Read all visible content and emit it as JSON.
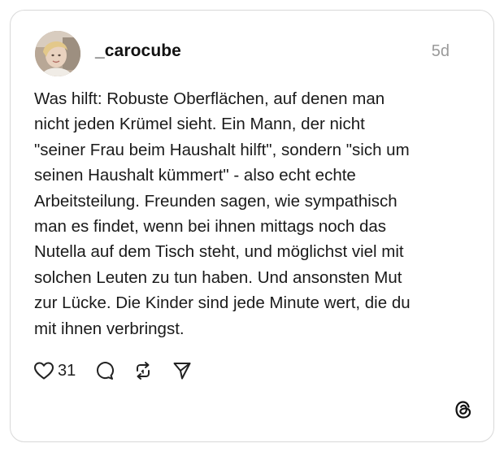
{
  "post": {
    "username": "_carocube",
    "timestamp": "5d",
    "text": "Was hilft: Robuste Oberflächen, auf denen man\nnicht jeden Krümel sieht. Ein Mann, der nicht\n\"seiner Frau beim Haushalt hilft\", sondern \"sich um\nseinen Haushalt kümmert\" - also echt echte\nArbeitsteilung. Freunden sagen, wie sympathisch\nman es findet, wenn bei ihnen mittags noch das\nNutella auf dem Tisch steht, und möglichst viel mit\nsolchen Leuten zu tun haben. Und ansonsten Mut\nzur Lücke. Die Kinder sind jede Minute wert, die du\nmit ihnen verbringst."
  },
  "actions": {
    "like_count": "31",
    "icons": [
      "heart-icon",
      "comment-icon",
      "repost-icon",
      "share-icon"
    ]
  },
  "branding": {
    "logo_icon": "threads-logo-icon"
  },
  "colors": {
    "text": "#1a1a1a",
    "muted": "#9a9a9a",
    "border": "#d9d9d9"
  }
}
